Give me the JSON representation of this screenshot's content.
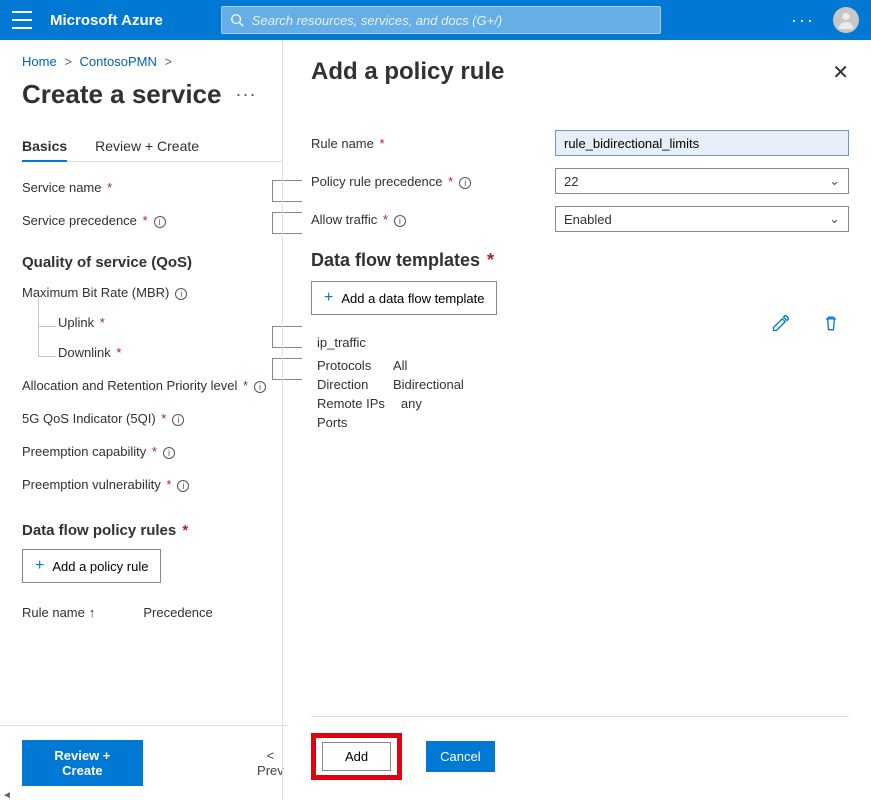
{
  "topbar": {
    "brand": "Microsoft Azure",
    "search_placeholder": "Search resources, services, and docs (G+/)"
  },
  "breadcrumb": {
    "home": "Home",
    "second": "ContosoPMN"
  },
  "page": {
    "title": "Create a service",
    "tabs": {
      "basics": "Basics",
      "review": "Review + Create"
    }
  },
  "left_form": {
    "service_name": "Service name",
    "service_precedence": "Service precedence",
    "qos_heading": "Quality of service (QoS)",
    "mbr": "Maximum Bit Rate (MBR)",
    "uplink": "Uplink",
    "downlink": "Downlink",
    "arp": "Allocation and Retention Priority level",
    "fiveqi": "5G QoS Indicator (5QI)",
    "preempt_cap": "Preemption capability",
    "preempt_vul": "Preemption vulnerability",
    "rules_heading": "Data flow policy rules",
    "add_policy_rule": "Add a policy rule",
    "col_rulename": "Rule name",
    "col_precedence": "Precedence",
    "review_btn": "Review + Create",
    "prev_btn": "< Prev"
  },
  "panel": {
    "title": "Add a policy rule",
    "rule_name_label": "Rule name",
    "rule_name_value": "rule_bidirectional_limits",
    "precedence_label": "Policy rule precedence",
    "precedence_value": "22",
    "allow_label": "Allow traffic",
    "allow_value": "Enabled",
    "dft_heading": "Data flow templates",
    "add_dft": "Add a data flow template",
    "template": {
      "name": "ip_traffic",
      "protocols_k": "Protocols",
      "protocols_v": "All",
      "direction_k": "Direction",
      "direction_v": "Bidirectional",
      "remote_k": "Remote IPs",
      "remote_v": "any",
      "ports_k": "Ports",
      "ports_v": ""
    },
    "add_btn": "Add",
    "cancel_btn": "Cancel"
  }
}
